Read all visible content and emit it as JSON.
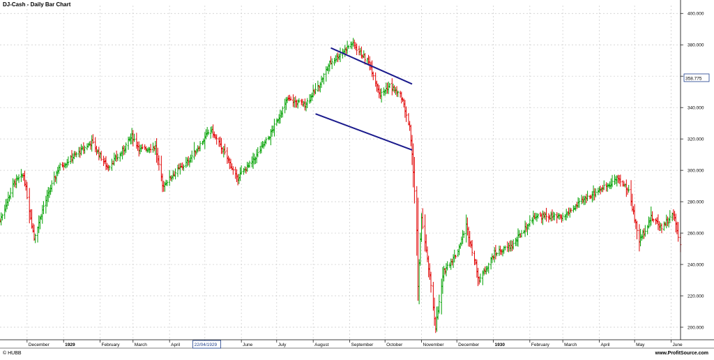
{
  "window": {
    "title": "DJ-Cash - Daily Bar Chart",
    "footer_left": "© HUBB",
    "footer_right": "www.ProfitSource.com"
  },
  "colors": {
    "up": "#00a000",
    "down": "#e00000",
    "trendline": "#1a1a8c",
    "grid": "#c8c8c8",
    "crosshair_box": "#1a3c8c"
  },
  "cursor": {
    "date_label": "22/04/1929",
    "price_label": "358.775"
  },
  "chart_data": {
    "type": "ohlc",
    "ylim": [
      192,
      405
    ],
    "y_ticks": [
      200,
      220,
      240,
      260,
      280,
      300,
      320,
      340,
      360,
      380,
      400
    ],
    "x_tick_labels": [
      "December",
      "1929",
      "February",
      "March",
      "April",
      "May",
      "June",
      "July",
      "August",
      "September",
      "October",
      "November",
      "December",
      "1930",
      "February",
      "March",
      "April",
      "May",
      "June"
    ],
    "x_tick_dates": [
      "1928-12-01",
      "1929-01-01",
      "1929-02-01",
      "1929-03-01",
      "1929-04-01",
      "1929-05-01",
      "1929-06-01",
      "1929-07-01",
      "1929-08-01",
      "1929-09-01",
      "1929-10-01",
      "1929-11-01",
      "1929-12-01",
      "1930-01-01",
      "1930-02-01",
      "1930-03-01",
      "1930-04-01",
      "1930-05-01",
      "1930-06-01"
    ],
    "x_range": [
      "1928-11-08",
      "1930-06-09"
    ],
    "grid": true,
    "anchors": [
      [
        "1928-11-08",
        268
      ],
      [
        "1928-11-20",
        292
      ],
      [
        "1928-11-28",
        297
      ],
      [
        "1928-12-07",
        257
      ],
      [
        "1928-12-15",
        277
      ],
      [
        "1928-12-28",
        302
      ],
      [
        "1929-01-05",
        306
      ],
      [
        "1929-01-25",
        318
      ],
      [
        "1929-02-07",
        302
      ],
      [
        "1929-02-18",
        310
      ],
      [
        "1929-02-28",
        322
      ],
      [
        "1929-03-07",
        313
      ],
      [
        "1929-03-20",
        315
      ],
      [
        "1929-03-26",
        290
      ],
      [
        "1929-04-05",
        298
      ],
      [
        "1929-04-16",
        305
      ],
      [
        "1929-05-06",
        326
      ],
      [
        "1929-05-20",
        308
      ],
      [
        "1929-05-28",
        295
      ],
      [
        "1929-06-10",
        305
      ],
      [
        "1929-06-25",
        322
      ],
      [
        "1929-07-10",
        345
      ],
      [
        "1929-07-25",
        342
      ],
      [
        "1929-08-05",
        353
      ],
      [
        "1929-08-15",
        368
      ],
      [
        "1929-09-03",
        381
      ],
      [
        "1929-09-18",
        368
      ],
      [
        "1929-09-27",
        348
      ],
      [
        "1929-10-05",
        354
      ],
      [
        "1929-10-15",
        347
      ],
      [
        "1929-10-22",
        327
      ],
      [
        "1929-10-25",
        300
      ],
      [
        "1929-10-28",
        262
      ],
      [
        "1929-10-29",
        225
      ],
      [
        "1929-11-01",
        270
      ],
      [
        "1929-11-08",
        232
      ],
      [
        "1929-11-13",
        200
      ],
      [
        "1929-11-20",
        236
      ],
      [
        "1929-12-01",
        247
      ],
      [
        "1929-12-09",
        265
      ],
      [
        "1929-12-20",
        230
      ],
      [
        "1930-01-02",
        247
      ],
      [
        "1930-01-17",
        252
      ],
      [
        "1930-02-05",
        271
      ],
      [
        "1930-03-01",
        270
      ],
      [
        "1930-03-20",
        282
      ],
      [
        "1930-04-17",
        295
      ],
      [
        "1930-04-26",
        287
      ],
      [
        "1930-05-05",
        255
      ],
      [
        "1930-05-15",
        270
      ],
      [
        "1930-05-24",
        264
      ],
      [
        "1930-06-03",
        272
      ],
      [
        "1930-06-09",
        252
      ]
    ],
    "trendlines": [
      {
        "from": [
          "1929-08-16",
          378
        ],
        "to": [
          "1929-10-24",
          355
        ]
      },
      {
        "from": [
          "1929-08-03",
          336
        ],
        "to": [
          "1929-10-24",
          313
        ]
      }
    ]
  }
}
